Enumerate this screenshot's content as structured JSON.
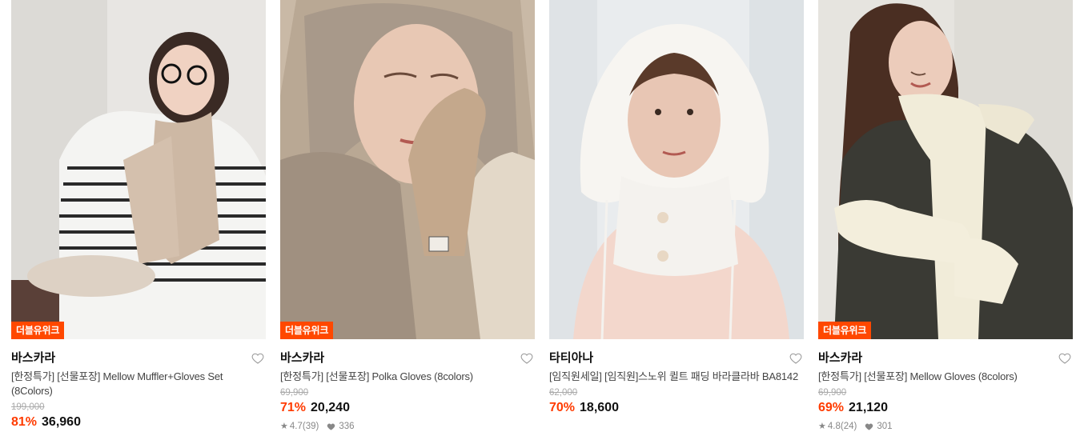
{
  "products": [
    {
      "badge": "더블유위크",
      "brand": "바스카라",
      "title": "[한정특가] [선물포장] Mellow Muffler+Gloves Set (8Colors)",
      "original_price": "199,000",
      "discount": "81%",
      "price": "36,960",
      "rating": "",
      "reviews": "",
      "likes": ""
    },
    {
      "badge": "더블유위크",
      "brand": "바스카라",
      "title": "[한정특가] [선물포장] Polka Gloves (8colors)",
      "original_price": "69,900",
      "discount": "71%",
      "price": "20,240",
      "rating": "4.7",
      "reviews": "(39)",
      "likes": "336"
    },
    {
      "badge": "",
      "brand": "타티아나",
      "title": "[임직원세일] [임직원]스노위 퀼트 패딩 바라클라바 BA8142",
      "original_price": "62,000",
      "discount": "70%",
      "price": "18,600",
      "rating": "",
      "reviews": "",
      "likes": ""
    },
    {
      "badge": "더블유위크",
      "brand": "바스카라",
      "title": "[한정특가] [선물포장] Mellow Gloves (8colors)",
      "original_price": "69,900",
      "discount": "69%",
      "price": "21,120",
      "rating": "4.8",
      "reviews": "(24)",
      "likes": "301"
    }
  ],
  "colors": {
    "accent": "#ff3b00",
    "badge_bg": "#ff4800"
  }
}
